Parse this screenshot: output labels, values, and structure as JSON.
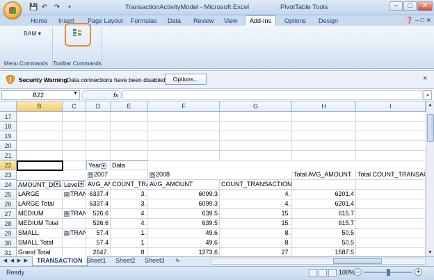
{
  "window": {
    "title": "TransactionActivityModel - Microsoft Excel",
    "context_title": "PivotTable Tools",
    "qat": [
      "save-icon",
      "undo-icon",
      "redo-icon",
      "dropdown-icon"
    ],
    "controls": [
      "minimize",
      "maximize",
      "close"
    ]
  },
  "tabs": [
    "Home",
    "Insert",
    "Page Layout",
    "Formulas",
    "Data",
    "Review",
    "View",
    "Add-Ins",
    "Options",
    "Design"
  ],
  "active_tab": "Add-Ins",
  "ribbon": {
    "bam_label": "BAM",
    "group1_label": "Menu Commands",
    "group2_label": "Toolbar Commands"
  },
  "security": {
    "title": "Security Warning",
    "message": "Data connections have been disabled",
    "button": "Options..."
  },
  "formula_bar": {
    "name_box": "B22",
    "fx": "fx",
    "value": ""
  },
  "columns": [
    "B",
    "C",
    "D",
    "E",
    "F",
    "G",
    "H",
    "I"
  ],
  "rows": [
    "17",
    "18",
    "19",
    "20",
    "21",
    "22",
    "23",
    "24",
    "25",
    "26",
    "27",
    "28",
    "29",
    "30",
    "31"
  ],
  "pivot": {
    "row22": {
      "year": "Year",
      "data": "Data"
    },
    "row23": {
      "y2007": "2007",
      "y2008": "2008",
      "total_avg": "Total AVG_AMOUNT",
      "total_count": "Total COUNT_TRANSACTION"
    },
    "row24": {
      "amount": "AMOUNT_DESC",
      "level": "Level",
      "avg1": "AVG_AMOUNT",
      "cnt1": "COUNT_TRANSACTION",
      "avg2": "AVG_AMOUNT",
      "cnt2": "COUNT_TRANSACTION"
    },
    "data_rows": [
      {
        "b": "LARGE",
        "c": "TRANS",
        "d": "6337.4",
        "e": "3.",
        "f": "6099.3",
        "g": "4.",
        "h": "6201.4",
        "i": ""
      },
      {
        "b": "LARGE Total",
        "c": "",
        "d": "6337.4",
        "e": "3.",
        "f": "6099.3",
        "g": "4.",
        "h": "6201.4",
        "i": ""
      },
      {
        "b": "MEDIUM",
        "c": "TRANS",
        "d": "526.6",
        "e": "4.",
        "f": "639.5",
        "g": "15.",
        "h": "615.7",
        "i": ""
      },
      {
        "b": "MEDIUM Total",
        "c": "",
        "d": "526.6",
        "e": "4.",
        "f": "639.5",
        "g": "15.",
        "h": "615.7",
        "i": ""
      },
      {
        "b": "SMALL",
        "c": "TRANS",
        "d": "57.4",
        "e": "1.",
        "f": "49.6",
        "g": "8.",
        "h": "50.5",
        "i": ""
      },
      {
        "b": "SMALL Total",
        "c": "",
        "d": "57.4",
        "e": "1.",
        "f": "49.6",
        "g": "8.",
        "h": "50.5",
        "i": ""
      },
      {
        "b": "Grand Total",
        "c": "",
        "d": "2647.",
        "e": "8.",
        "f": "1273.6",
        "g": "27.",
        "h": "1587.5",
        "i": ""
      }
    ]
  },
  "sheets": [
    "TRANSACTION",
    "Sheet1",
    "Sheet2",
    "Sheet3"
  ],
  "active_sheet": "TRANSACTION",
  "status": {
    "text": "Ready",
    "zoom": "100%"
  },
  "colors": {
    "accent": "#ef8a2f",
    "ribbon": "#dbe7f5",
    "select": "#f9cb6b"
  }
}
